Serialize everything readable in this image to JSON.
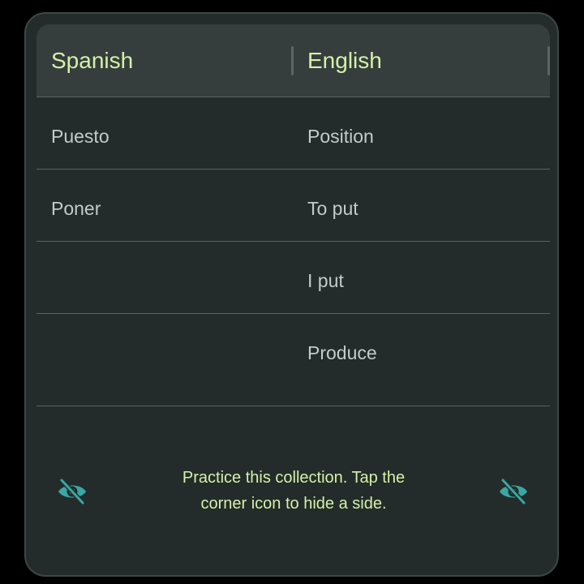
{
  "table": {
    "headers": {
      "spanish": "Spanish",
      "english": "English"
    },
    "rows": [
      {
        "spanish": "Puesto",
        "english": "Position"
      },
      {
        "spanish": "Poner",
        "english": "To put"
      },
      {
        "spanish": "",
        "english": "I put"
      },
      {
        "spanish": "",
        "english": "Produce"
      }
    ]
  },
  "footer": {
    "line1": "Practice this collection. Tap the",
    "line2": "corner icon to hide a side."
  },
  "icons": {
    "left": "eye-off-icon",
    "right": "eye-off-icon"
  },
  "colors": {
    "accent_text": "#d6f0a8",
    "icon": "#3aa7a3",
    "card_bg": "#232c2b",
    "header_bg": "#353e3d"
  }
}
